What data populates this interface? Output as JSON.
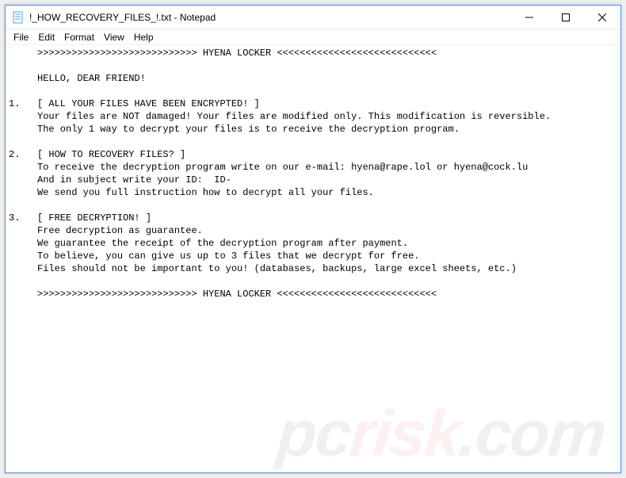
{
  "titlebar": {
    "icon": "notepad-icon",
    "title": "!_HOW_RECOVERY_FILES_!.txt - Notepad"
  },
  "window_controls": {
    "minimize": "—",
    "maximize": "☐",
    "close": "✕"
  },
  "menubar": {
    "file": "File",
    "edit": "Edit",
    "format": "Format",
    "view": "View",
    "help": "Help"
  },
  "body_text": "     >>>>>>>>>>>>>>>>>>>>>>>>>>>> HYENA LOCKER <<<<<<<<<<<<<<<<<<<<<<<<<<<<\n\n     HELLO, DEAR FRIEND!\n\n1.   [ ALL YOUR FILES HAVE BEEN ENCRYPTED! ]\n     Your files are NOT damaged! Your files are modified only. This modification is reversible.\n     The only 1 way to decrypt your files is to receive the decryption program.\n\n2.   [ HOW TO RECOVERY FILES? ]\n     To receive the decryption program write on our e-mail: hyena@rape.lol or hyena@cock.lu\n     And in subject write your ID:  ID-\n     We send you full instruction how to decrypt all your files.\n\n3.   [ FREE DECRYPTION! ]\n     Free decryption as guarantee.\n     We guarantee the receipt of the decryption program after payment.\n     To believe, you can give us up to 3 files that we decrypt for free.\n     Files should not be important to you! (databases, backups, large excel sheets, etc.)\n\n     >>>>>>>>>>>>>>>>>>>>>>>>>>>> HYENA LOCKER <<<<<<<<<<<<<<<<<<<<<<<<<<<<",
  "watermark": {
    "pc": "pc",
    "risk": "risk",
    "com": ".com"
  }
}
